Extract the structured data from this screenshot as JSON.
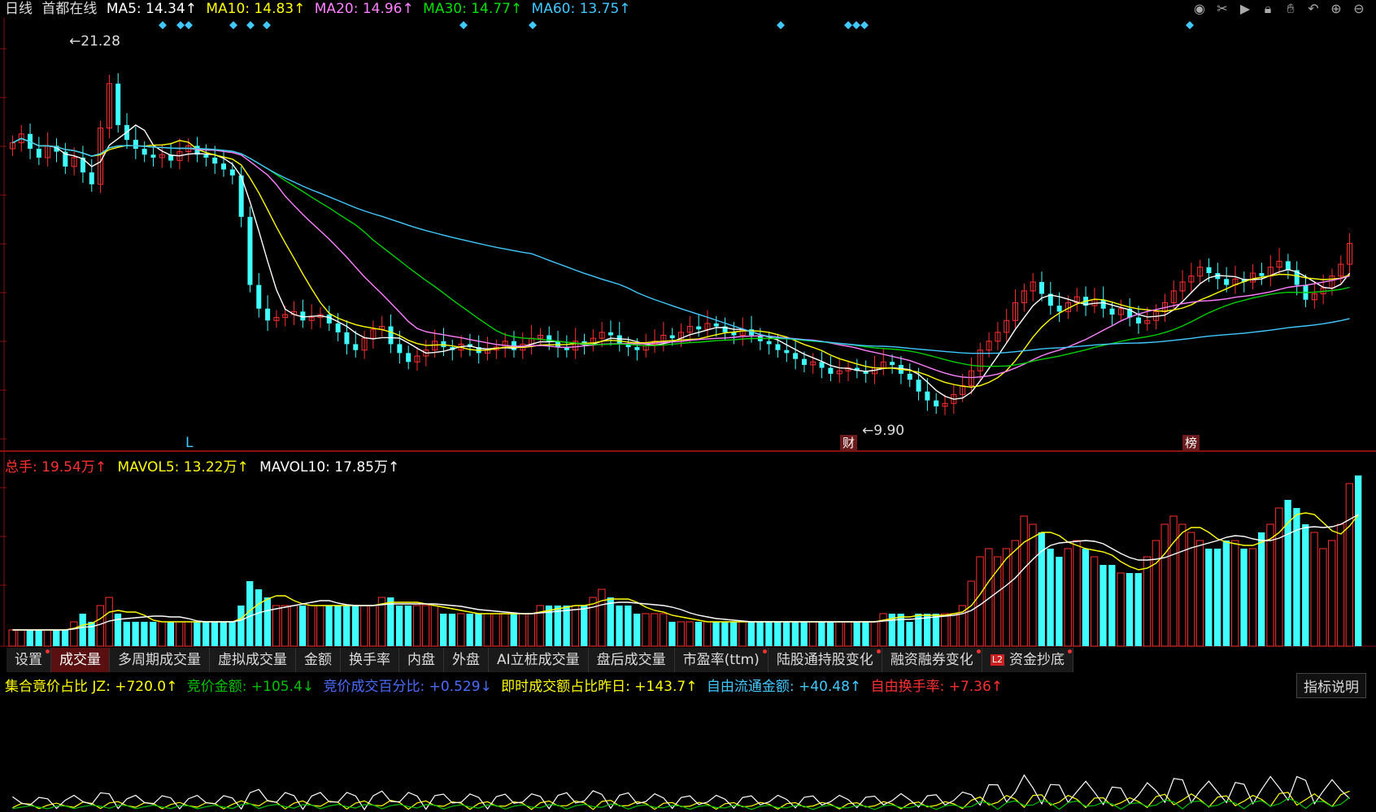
{
  "header": {
    "period": "日线",
    "stock": "首都在线",
    "ma": [
      {
        "label": "MA5: 14.34↑",
        "color": "#ffffff"
      },
      {
        "label": "MA10: 14.83↑",
        "color": "#ffff00"
      },
      {
        "label": "MA20: 14.96↑",
        "color": "#ff80ff"
      },
      {
        "label": "MA30: 14.77↑",
        "color": "#00e000"
      },
      {
        "label": "MA60: 13.75↑",
        "color": "#40c8ff"
      }
    ]
  },
  "tools": [
    "eye-icon",
    "scissors-icon",
    "play-icon",
    "lock-icon",
    "hand-icon",
    "undo-icon",
    "zoom-in-icon",
    "zoom-out-icon"
  ],
  "price_labels": {
    "high": "21.28",
    "low": "9.90",
    "L_marker": "L",
    "cai_marker": "财",
    "bang_marker": "榜"
  },
  "volume_header": [
    {
      "label": "总手: 19.54万↑",
      "color": "#ff3030"
    },
    {
      "label": "MAVOL5: 13.22万↑",
      "color": "#ffff00"
    },
    {
      "label": "MAVOL10: 17.85万↑",
      "color": "#ffffff"
    }
  ],
  "tabs": [
    {
      "label": "设置",
      "dot": true
    },
    {
      "label": "成交量",
      "active": true
    },
    {
      "label": "多周期成交量"
    },
    {
      "label": "虚拟成交量"
    },
    {
      "label": "金额"
    },
    {
      "label": "换手率"
    },
    {
      "label": "内盘"
    },
    {
      "label": "外盘"
    },
    {
      "label": "AI立桩成交量"
    },
    {
      "label": "盘后成交量"
    },
    {
      "label": "市盈率(ttm)",
      "dot": true
    },
    {
      "label": "陆股通持股变化",
      "dot": true
    },
    {
      "label": "融资融券变化",
      "dot": true
    },
    {
      "label": "资金抄底",
      "dot": true,
      "l2": "L2"
    }
  ],
  "indicator_header": [
    {
      "label": "集合竟价占比 JZ: +720.0↑",
      "color": "#ffff00"
    },
    {
      "label": "竞价金额: +105.4↓",
      "color": "#00c000"
    },
    {
      "label": "竞价成交百分比: +0.529↓",
      "color": "#4a6cff"
    },
    {
      "label": "即时成交额占比昨日: +143.7↑",
      "color": "#ffff00"
    },
    {
      "label": "自由流通金额: +40.48↑",
      "color": "#40c8ff"
    },
    {
      "label": "自由换手率: +7.36↑",
      "color": "#ff3030"
    }
  ],
  "help_label": "指标说明",
  "chart_data": {
    "type": "candlestick",
    "price_range": [
      9.0,
      23.0
    ],
    "high_label": 21.28,
    "low_label": 9.9,
    "closes": [
      19.0,
      19.3,
      18.8,
      18.5,
      18.9,
      18.7,
      18.2,
      18.5,
      18.0,
      17.6,
      19.5,
      21.0,
      19.6,
      19.1,
      18.8,
      18.6,
      18.5,
      18.6,
      18.4,
      18.7,
      18.9,
      18.6,
      18.5,
      18.3,
      18.1,
      17.9,
      16.5,
      14.2,
      13.4,
      13.0,
      13.1,
      13.2,
      13.3,
      13.0,
      13.1,
      13.2,
      12.9,
      12.6,
      12.2,
      12.0,
      12.4,
      12.7,
      12.8,
      12.2,
      11.9,
      11.6,
      11.8,
      12.0,
      12.3,
      12.1,
      12.0,
      12.2,
      12.1,
      11.9,
      12.0,
      12.1,
      12.3,
      12.0,
      12.2,
      12.4,
      12.5,
      12.3,
      12.1,
      12.0,
      12.3,
      12.2,
      12.4,
      12.6,
      12.5,
      12.2,
      12.1,
      12.0,
      12.2,
      12.3,
      12.5,
      12.4,
      12.6,
      12.8,
      12.7,
      12.9,
      12.8,
      12.6,
      12.5,
      12.7,
      12.5,
      12.3,
      12.2,
      12.0,
      11.9,
      11.7,
      11.5,
      11.6,
      11.4,
      11.2,
      11.3,
      11.4,
      11.3,
      11.2,
      11.4,
      11.6,
      11.5,
      11.2,
      11.0,
      10.6,
      10.3,
      10.1,
      10.2,
      10.5,
      10.8,
      11.3,
      12.0,
      12.3,
      12.6,
      13.0,
      13.6,
      14.0,
      14.3,
      13.9,
      13.5,
      13.3,
      13.6,
      13.8,
      13.5,
      13.7,
      13.4,
      13.2,
      13.4,
      13.1,
      12.9,
      13.0,
      13.3,
      13.6,
      14.0,
      14.3,
      14.5,
      14.8,
      14.6,
      14.4,
      14.2,
      14.4,
      14.3,
      14.6,
      14.5,
      14.8,
      15.0,
      14.7,
      14.2,
      13.7,
      13.9,
      14.1,
      14.5,
      14.9,
      15.6
    ],
    "volumes": [
      2,
      2,
      2,
      2,
      2,
      2,
      2,
      3,
      4,
      3,
      5,
      6,
      4,
      3,
      3,
      3,
      3,
      3,
      3,
      3,
      3,
      3,
      3,
      3,
      3,
      3,
      5,
      8,
      7,
      6,
      5,
      5,
      5,
      5,
      5,
      5,
      5,
      5,
      5,
      5,
      5,
      5,
      6,
      6,
      5,
      5,
      5,
      5,
      5,
      4,
      4,
      4,
      4,
      4,
      4,
      4,
      4,
      4,
      4,
      4,
      5,
      5,
      5,
      5,
      5,
      5,
      6,
      7,
      6,
      5,
      5,
      4,
      4,
      4,
      4,
      3,
      3,
      3,
      3,
      3,
      3,
      3,
      3,
      3,
      3,
      3,
      3,
      3,
      3,
      3,
      3,
      3,
      3,
      3,
      3,
      3,
      3,
      3,
      3,
      4,
      4,
      4,
      3,
      4,
      4,
      4,
      4,
      4,
      5,
      8,
      11,
      12,
      11,
      12,
      13,
      16,
      15,
      14,
      12,
      11,
      12,
      13,
      12,
      11,
      10,
      10,
      9,
      9,
      9,
      11,
      13,
      15,
      16,
      15,
      14,
      13,
      12,
      12,
      13,
      13,
      12,
      12,
      14,
      15,
      17,
      18,
      17,
      15,
      14,
      12,
      13,
      15,
      20,
      21
    ]
  }
}
